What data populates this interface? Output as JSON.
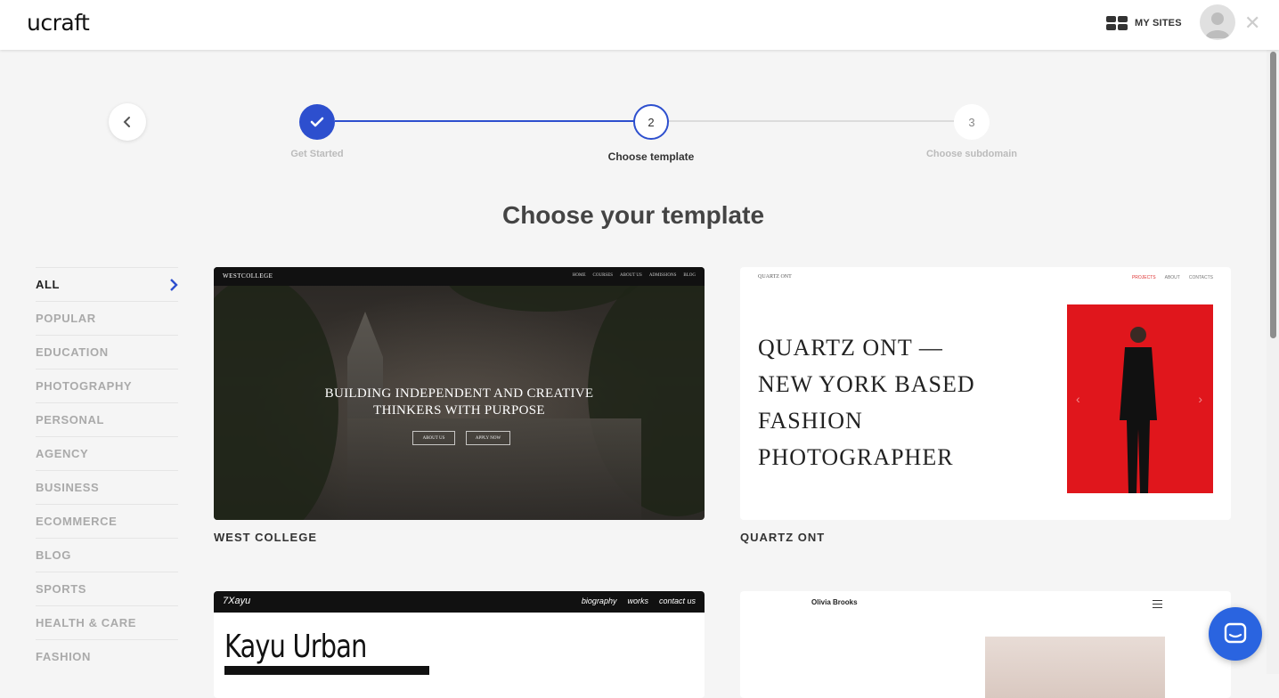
{
  "header": {
    "logo": "ucraft",
    "my_sites_label": "MY SITES",
    "close_glyph": "✕"
  },
  "stepper": {
    "steps": [
      {
        "label": "Get Started",
        "number": "",
        "state": "done"
      },
      {
        "label": "Choose template",
        "number": "2",
        "state": "active"
      },
      {
        "label": "Choose subdomain",
        "number": "3",
        "state": "todo"
      }
    ]
  },
  "page": {
    "title": "Choose your template"
  },
  "categories": {
    "items": [
      "ALL",
      "POPULAR",
      "EDUCATION",
      "PHOTOGRAPHY",
      "PERSONAL",
      "AGENCY",
      "BUSINESS",
      "ECOMMERCE",
      "BLOG",
      "SPORTS",
      "HEALTH & CARE",
      "FASHION"
    ],
    "active": "ALL"
  },
  "templates": [
    {
      "name": "WEST COLLEGE",
      "preview": {
        "brand": "WESTCOLLEGE",
        "nav": [
          "HOME",
          "COURSES",
          "ABOUT US",
          "ADMISSIONS",
          "BLOG"
        ],
        "headline_1": "BUILDING INDEPENDENT AND CREATIVE",
        "headline_2": "THINKERS WITH PURPOSE",
        "button_1": "ABOUT US",
        "button_2": "APPLY NOW"
      }
    },
    {
      "name": "QUARTZ ONT",
      "preview": {
        "brand": "QUARTZ ONT",
        "nav": [
          "PROJECTS",
          "ABOUT",
          "CONTACTS"
        ],
        "headline_lines": [
          "QUARTZ ONT —",
          "NEW YORK BASED",
          "FASHION",
          "PHOTOGRAPHER"
        ]
      }
    },
    {
      "name": "",
      "preview": {
        "brand": "7Xayu",
        "nav": [
          "biography",
          "works",
          "contact us"
        ],
        "title": "Kayu Urban"
      }
    },
    {
      "name": "",
      "preview": {
        "brand": "Olivia Brooks"
      }
    }
  ],
  "colors": {
    "accent": "#2d4fce",
    "chat": "#2a64e0",
    "qz_red": "#e0161c"
  }
}
